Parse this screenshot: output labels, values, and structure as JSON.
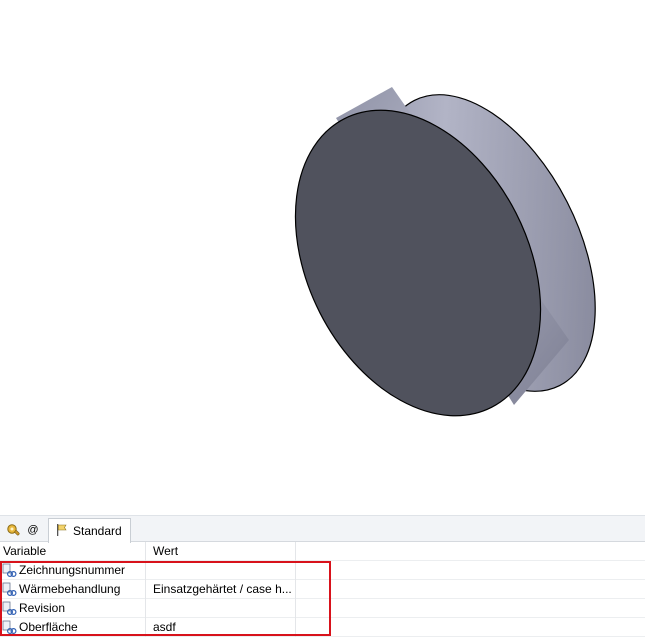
{
  "viewport": {
    "object": "cylinder-part",
    "face_color": "#50525d",
    "side_color": "#9ea1b4",
    "outline_color": "#000000"
  },
  "tabs": {
    "icon1": "tool-icon",
    "icon2_label": "@",
    "standard_label": "Standard"
  },
  "grid": {
    "headers": [
      "Variable",
      "Wert"
    ],
    "rows": [
      {
        "variable": "Zeichnungsnummer",
        "value": ""
      },
      {
        "variable": "Wärmebehandlung",
        "value": "Einsatzgehärtet / case h..."
      },
      {
        "variable": "Revision",
        "value": ""
      },
      {
        "variable": "Oberfläche",
        "value": "asdf"
      }
    ]
  },
  "highlight_color": "#d8121b"
}
